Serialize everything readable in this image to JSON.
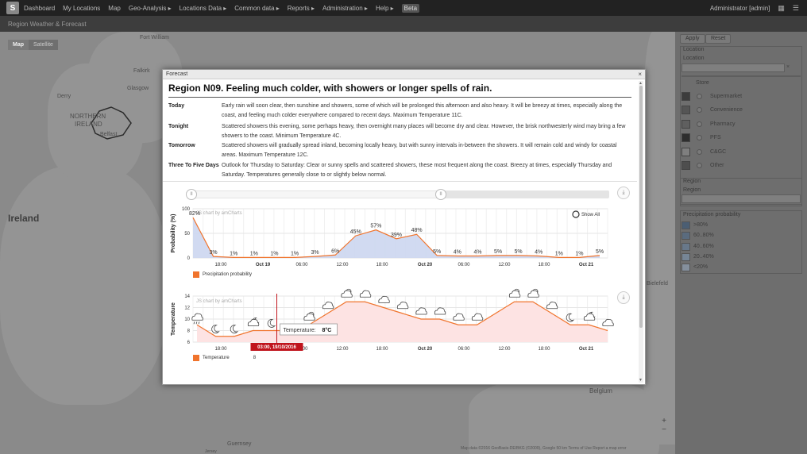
{
  "nav": {
    "logo": "S",
    "items": [
      "Dashboard",
      "My Locations",
      "Map",
      "Geo-Analysis ▸",
      "Locations Data ▸",
      "Common data ▸",
      "Reports ▸",
      "Administration ▸",
      "Help ▸"
    ],
    "badge": "Beta",
    "user": "Administrator [admin]"
  },
  "subheader": {
    "title": "Region Weather & Forecast"
  },
  "map": {
    "map_types": [
      "Map",
      "Satellite"
    ],
    "labels": [
      {
        "text": "Fort William"
      },
      {
        "text": "Falkirk"
      },
      {
        "text": "Glasgow"
      },
      {
        "text": "Derry"
      },
      {
        "text": "NORTHERN"
      },
      {
        "text": "IRELAND"
      },
      {
        "text": "Belfast"
      },
      {
        "text": "Ireland"
      },
      {
        "text": "Bielefeld"
      },
      {
        "text": "Guernsey"
      },
      {
        "text": "Belgium"
      },
      {
        "text": "Jersey"
      }
    ],
    "zoom_in": "+",
    "zoom_out": "−",
    "attribution": "Map data ©2016 GeoBasis-DE/BKG (©2009), Google   50 km   Terms of Use   Report a map error"
  },
  "panel": {
    "apply": "Apply",
    "reset": "Reset",
    "location_section": "Location",
    "location_label": "Location",
    "stores_label": "Store",
    "stores": [
      {
        "name": "Supermarket",
        "color": "#3c3c3c"
      },
      {
        "name": "Convenience",
        "color": "#555555"
      },
      {
        "name": "Pharmacy",
        "color": "#5f5f5f"
      },
      {
        "name": "PFS",
        "color": "#2e2e2e"
      },
      {
        "name": "C&GC",
        "color": "#7f7f7f"
      },
      {
        "name": "Other",
        "color": "#4e4e4e"
      }
    ],
    "region_section": "Region",
    "region_label": "Region",
    "precip_section": "Precipitation probability",
    "precip": [
      {
        "name": ">80%",
        "color": "#4b5e73"
      },
      {
        "name": "60..80%",
        "color": "#5a6b7e"
      },
      {
        "name": "40..60%",
        "color": "#68788a"
      },
      {
        "name": "20..40%",
        "color": "#768595"
      },
      {
        "name": "<20%",
        "color": "#848f9c"
      }
    ]
  },
  "modal": {
    "title": "Forecast",
    "close": "×",
    "headline": "Region N09. Feeling much colder, with showers or longer spells of rain.",
    "forecasts": [
      {
        "label": "Today",
        "text": "Early rain will soon clear, then sunshine and showers, some of which will be prolonged this afternoon and also heavy. It will be breezy at times, especially along the coast, and feeling much colder everywhere compared to recent days. Maximum Temperature 11C."
      },
      {
        "label": "Tonight",
        "text": "Scattered showers this evening, some perhaps heavy, then overnight many places will become dry and clear. However, the brisk northwesterly wind may bring a few showers to the coast. Minimum Temperature 4C."
      },
      {
        "label": "Tomorrow",
        "text": "Scattered showers will gradually spread inland, becoming locally heavy, but with sunny intervals in-between the showers. It will remain cold and windy for coastal areas. Maximum Temperature 12C."
      },
      {
        "label": "Three To Five Days",
        "text": "Outlook for Thursday to Saturday: Clear or sunny spells and scattered showers, these most frequent along the coast. Breezy at times, especially Thursday and Saturday. Temperatures generally close to or slightly below normal."
      }
    ],
    "grip": "II",
    "download": "⤓"
  },
  "chart_data": [
    {
      "type": "area",
      "ylabel": "Probability (%)",
      "ylim": [
        0,
        100
      ],
      "yticks": [
        0,
        50,
        100
      ],
      "credit": "JS chart by amCharts",
      "show_all": "Show All",
      "xticks": [
        "18:00",
        "Oct 19",
        "06:00",
        "12:00",
        "18:00",
        "Oct 20",
        "06:00",
        "12:00",
        "18:00",
        "Oct 21"
      ],
      "series": [
        {
          "name": "Precipitation probability",
          "color": "#f0742d",
          "fill": "#ccd6f0",
          "values": [
            82,
            3,
            1,
            1,
            1,
            1,
            3,
            6,
            45,
            57,
            39,
            48,
            5,
            4,
            4,
            5,
            5,
            4,
            1,
            1,
            5
          ],
          "labels": [
            "82%",
            "3%",
            "1%",
            "1%",
            "1%",
            "1%",
            "3%",
            "6%",
            "45%",
            "57%",
            "39%",
            "48%",
            "5%",
            "4%",
            "4%",
            "5%",
            "5%",
            "4%",
            "1%",
            "1%",
            "5%"
          ]
        }
      ]
    },
    {
      "type": "line",
      "ylabel": "Temperature",
      "ylim": [
        6,
        14
      ],
      "yticks": [
        6,
        8,
        10,
        12,
        14
      ],
      "credit": "JS chart by amCharts",
      "xticks": [
        "18:00",
        "Oct 19",
        "06:00",
        "12:00",
        "18:00",
        "Oct 20",
        "06:00",
        "12:00",
        "18:00",
        "Oct 21"
      ],
      "series": [
        {
          "name": "Temperature",
          "color": "#f0742d",
          "fill": "#fde3e3",
          "values": [
            9,
            7,
            7,
            8,
            8,
            8,
            9,
            11,
            13,
            13,
            12,
            11,
            10,
            10,
            9,
            9,
            11,
            13,
            13,
            11,
            9,
            9,
            8
          ]
        }
      ],
      "weather_icons": [
        "rain-cloud",
        "moon",
        "moon",
        "cloud-moon",
        "moon",
        "sun-cloud",
        "cloud",
        "sun-cloud",
        "cloud",
        "cloud",
        "cloud",
        "cloud",
        "cloud",
        "cloud",
        "cloud",
        "sun-cloud",
        "sun-cloud",
        "cloud",
        "moon",
        "cloud-moon",
        "cloud"
      ],
      "cursor": {
        "time": "03:00, 19/10/2016",
        "tooltip_label": "Temperature:",
        "tooltip_value": "8°C"
      },
      "legend_value": "8"
    }
  ]
}
